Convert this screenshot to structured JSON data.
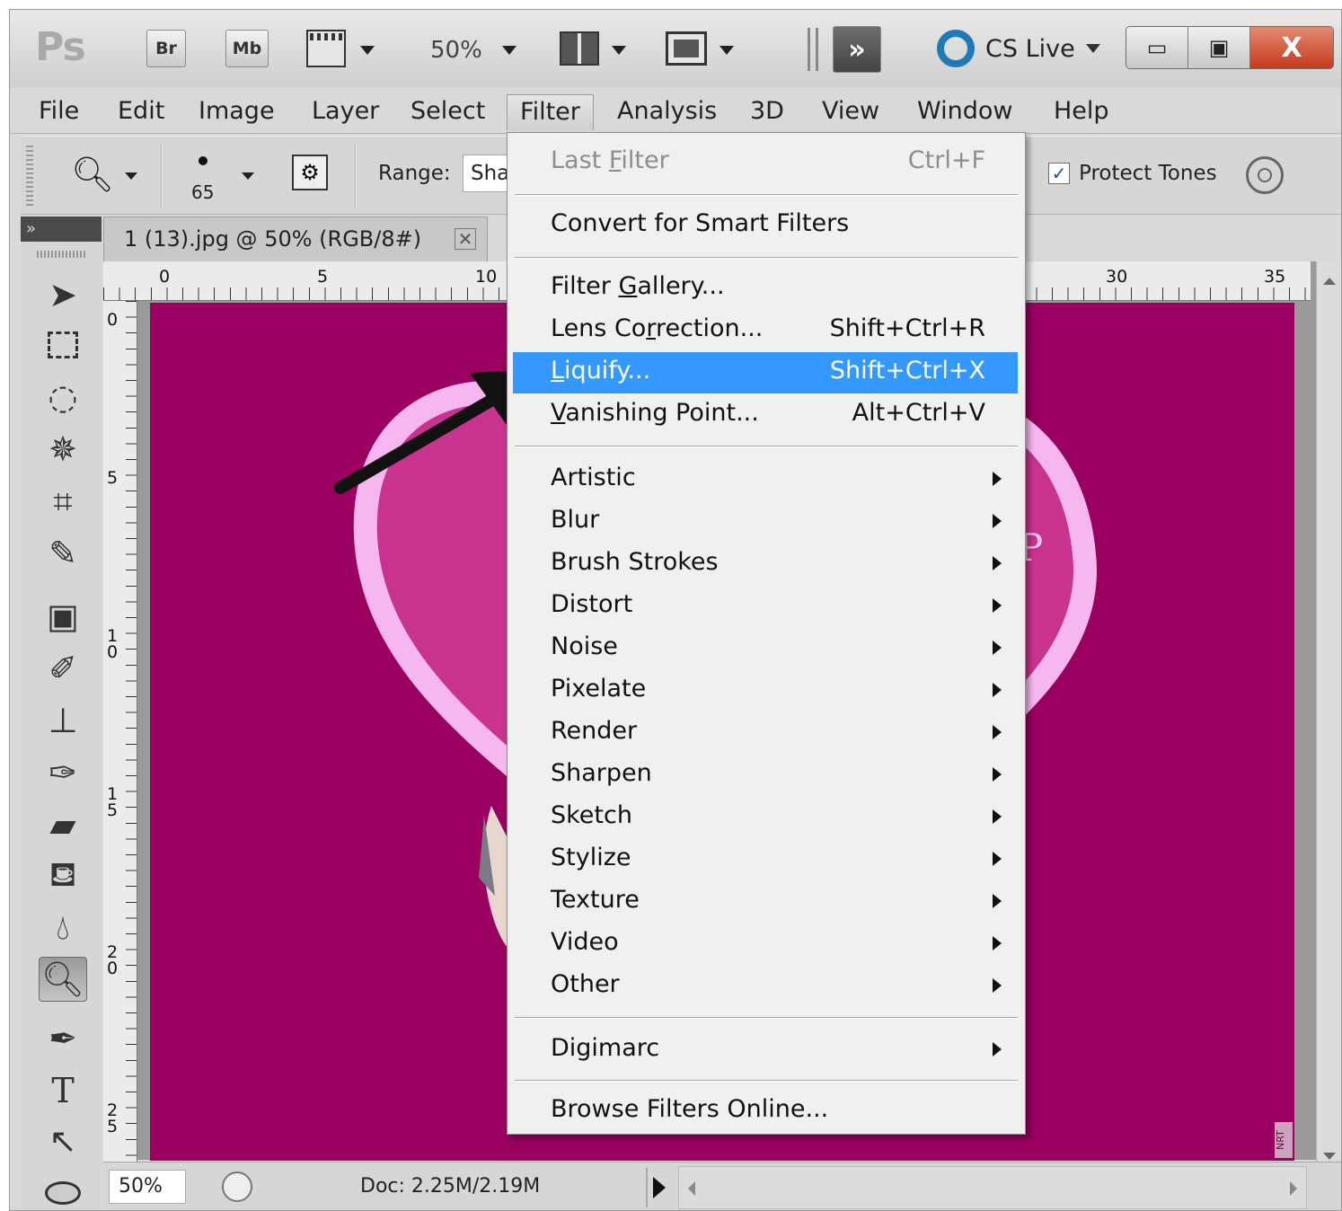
{
  "titlebar": {
    "logo": "Ps",
    "bridge_label": "Br",
    "minibridge_label": "Mb",
    "zoom": "50%",
    "cslive": "CS Live",
    "window_close": "X"
  },
  "menubar": [
    "File",
    "Edit",
    "Image",
    "Layer",
    "Select",
    "Filter",
    "Analysis",
    "3D",
    "View",
    "Window",
    "Help"
  ],
  "options": {
    "brush_size": "65",
    "range_label": "Range:",
    "range_value": "Shadows",
    "protect_tones": "Protect Tones",
    "protect_checked": true
  },
  "document": {
    "tab_title": "1 (13).jpg @ 50% (RGB/8#)",
    "ruler_top": [
      "0",
      "5",
      "10",
      "30",
      "35"
    ],
    "ruler_left": [
      "0",
      "5",
      "1\n0",
      "1\n5",
      "2\n0",
      "2\n5"
    ],
    "canvas_color": "#990060",
    "canvas_letter": "P",
    "watermark": "NRT"
  },
  "status": {
    "zoom": "50%",
    "doc": "Doc: 2.25M/2.19M"
  },
  "filter_menu": {
    "highlight_color": "#3399ff",
    "last_filter": {
      "label": "Last Filter",
      "shortcut": "Ctrl+F"
    },
    "convert": "Convert for Smart Filters",
    "gallery": "Filter Gallery...",
    "lens": {
      "label": "Lens Correction...",
      "shortcut": "Shift+Ctrl+R"
    },
    "liquify": {
      "label": "Liquify...",
      "shortcut": "Shift+Ctrl+X"
    },
    "vanishing": {
      "label": "Vanishing Point...",
      "shortcut": "Alt+Ctrl+V"
    },
    "submenus": [
      "Artistic",
      "Blur",
      "Brush Strokes",
      "Distort",
      "Noise",
      "Pixelate",
      "Render",
      "Sharpen",
      "Sketch",
      "Stylize",
      "Texture",
      "Video",
      "Other"
    ],
    "digimarc": "Digimarc",
    "browse": "Browse Filters Online..."
  }
}
